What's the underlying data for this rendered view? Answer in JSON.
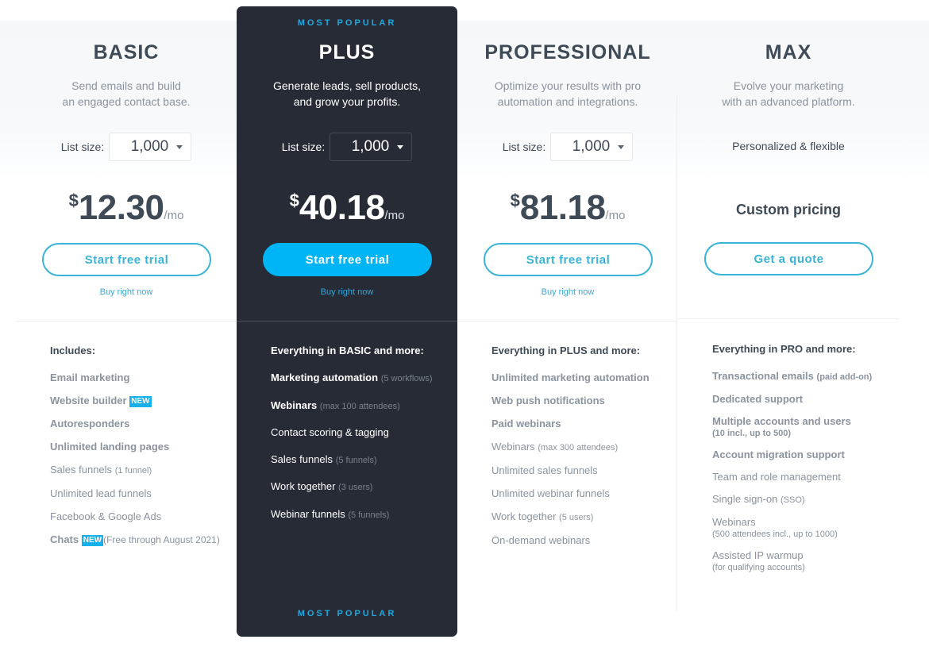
{
  "popular_label": "MOST POPULAR",
  "plans": [
    {
      "name": "BASIC",
      "description": [
        "Send emails and build",
        "an engaged contact base."
      ],
      "list_size_label": "List size:",
      "list_size_value": "1,000",
      "currency": "$",
      "price": "12.30",
      "per": "/mo",
      "cta": "Start free trial",
      "buy_link": "Buy right now",
      "features_heading": "Includes:",
      "features": [
        {
          "text": "Email marketing",
          "bold": true
        },
        {
          "text": "Website builder",
          "bold": true,
          "badge": "NEW"
        },
        {
          "text": "Autoresponders",
          "bold": true
        },
        {
          "text": "Unlimited landing pages",
          "bold": true
        },
        {
          "text": "Sales funnels",
          "note": "(1 funnel)"
        },
        {
          "text": "Unlimited lead funnels"
        },
        {
          "text": "Facebook & Google Ads"
        },
        {
          "text": "Chats",
          "bold": true,
          "badge": "NEW",
          "note": "(Free through August 2021)"
        }
      ]
    },
    {
      "name": "PLUS",
      "highlighted": true,
      "description": [
        "Generate leads, sell products,",
        "and grow your profits."
      ],
      "list_size_label": "List size:",
      "list_size_value": "1,000",
      "currency": "$",
      "price": "40.18",
      "per": "/mo",
      "cta": "Start free trial",
      "buy_link": "Buy right now",
      "features_heading": "Everything in BASIC and more:",
      "features": [
        {
          "text": "Marketing automation",
          "bold": true,
          "note": "(5 workflows)"
        },
        {
          "text": "Webinars",
          "bold": true,
          "note": "(max 100 attendees)"
        },
        {
          "text": "Contact scoring & tagging"
        },
        {
          "text": "Sales funnels",
          "note": "(5 funnels)"
        },
        {
          "text": "Work together",
          "note": "(3 users)"
        },
        {
          "text": "Webinar funnels",
          "note": "(5 funnels)"
        }
      ]
    },
    {
      "name": "PROFESSIONAL",
      "description": [
        "Optimize your results with pro",
        "automation and integrations."
      ],
      "list_size_label": "List size:",
      "list_size_value": "1,000",
      "currency": "$",
      "price": "81.18",
      "per": "/mo",
      "cta": "Start free trial",
      "buy_link": "Buy right now",
      "features_heading": "Everything in PLUS and more:",
      "features": [
        {
          "text": "Unlimited marketing automation",
          "bold": true
        },
        {
          "text": "Web push notifications",
          "bold": true
        },
        {
          "text": "Paid webinars",
          "bold": true
        },
        {
          "text": "Webinars",
          "note": "(max 300 attendees)"
        },
        {
          "text": "Unlimited sales funnels"
        },
        {
          "text": "Unlimited webinar funnels"
        },
        {
          "text": "Work together",
          "note": "(5 users)"
        },
        {
          "text": "On-demand webinars"
        }
      ]
    },
    {
      "name": "MAX",
      "description": [
        "Evolve your marketing",
        "with an advanced platform."
      ],
      "flex_note": "Personalized & flexible",
      "custom_price": "Custom pricing",
      "cta": "Get a quote",
      "features_heading": "Everything in PRO and more:",
      "features": [
        {
          "text": "Transactional emails",
          "bold": true,
          "note": "(paid add-on)"
        },
        {
          "text": "Dedicated support",
          "bold": true
        },
        {
          "text": "Multiple accounts and users",
          "bold": true,
          "sub": "(10 incl., up to 500)"
        },
        {
          "text": "Account migration support",
          "bold": true
        },
        {
          "text": "Team and role management"
        },
        {
          "text": "Single sign-on",
          "note": "(SSO)"
        },
        {
          "text": "Webinars",
          "sub": "(500 attendees incl., up to 1000)"
        },
        {
          "text": "Assisted IP warmup",
          "sub": "(for qualifying accounts)"
        }
      ]
    }
  ],
  "colors": {
    "accent": "#39b3d7",
    "primary_button": "#00b5f5",
    "dark_card": "#262b35",
    "text_dark": "#3f4a57",
    "text_muted": "#8a939e",
    "badge": "#16b0ea"
  }
}
